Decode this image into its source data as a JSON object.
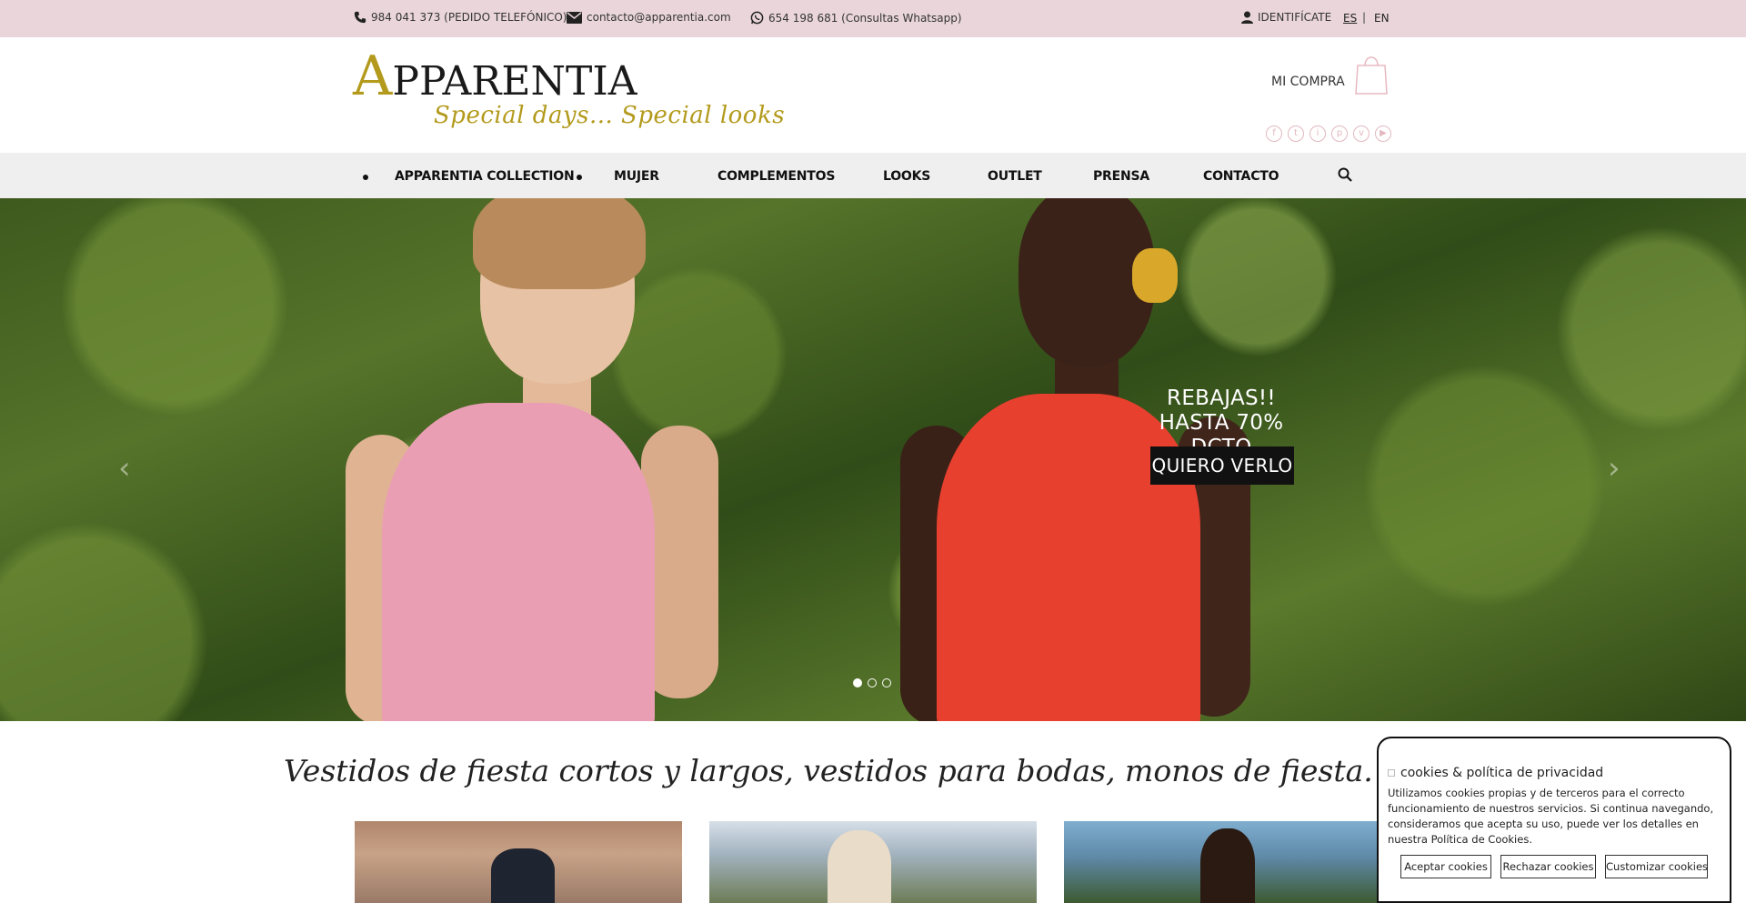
{
  "topbar": {
    "phone": "984 041 373 (PEDIDO TELEFÓNICO)",
    "email": "contacto@apparentia.com",
    "whatsapp": "654 198 681 (Consultas Whatsapp)",
    "login": "IDENTIFÍCATE",
    "lang_es": "ES",
    "lang_sep": "|",
    "lang_en": "EN"
  },
  "header": {
    "logo_first": "A",
    "logo_rest": "PPARENTIA",
    "logo_tagline": "Special days... Special looks",
    "cart_label": "MI COMPRA",
    "social": [
      "f",
      "t",
      "i",
      "p",
      "v",
      "▶"
    ]
  },
  "nav": {
    "items": [
      "APPARENTIA COLLECTION",
      "MUJER",
      "COMPLEMENTOS",
      "LOOKS",
      "OUTLET",
      "PRENSA",
      "CONTACTO"
    ]
  },
  "hero": {
    "title_line1": "REBAJAS!!",
    "title_line2": "HASTA 70% DCTO",
    "button": "QUIERO VERLO",
    "prev_arrow": "‹",
    "next_arrow": "›",
    "active_slide": 1,
    "slide_count": 3
  },
  "main": {
    "tagline": "Vestidos de fiesta cortos y largos, vestidos para bodas, monos de fiesta... para ser la invitada perfecta"
  },
  "cookie": {
    "title": "cookies & política de privacidad",
    "text": "Utilizamos cookies propias y de terceros para el correcto funcionamiento de nuestros servicios. Si continua navegando, consideramos que acepta su uso, puede ver los detalles en nuestra Política de Cookies.",
    "accept": "Aceptar cookies",
    "reject": "Rechazar cookies",
    "customize": "Customizar cookies"
  },
  "colors": {
    "topbar_bg": "#ead6da",
    "gold": "#b39a1c",
    "nav_bg": "#efefef",
    "social_pink": "#e2b8c0"
  }
}
